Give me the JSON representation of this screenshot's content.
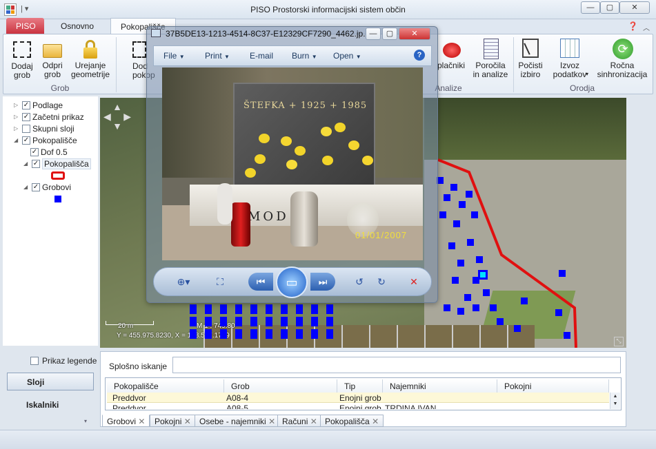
{
  "app": {
    "title": "PISO Prostorski informacijski sistem občin",
    "window_buttons": [
      "—",
      "▢",
      "✕"
    ]
  },
  "ribbon": {
    "tabs": [
      "PISO",
      "Osnovno",
      "Pokopališče"
    ],
    "group_grob": {
      "label": "Grob",
      "buttons": [
        "Dodaj\ngrob",
        "Odpri\ngrob",
        "Urejanje\ngeometrije"
      ]
    },
    "partial_button": "Dod\npokop",
    "group_analize": {
      "label": "Analize",
      "buttons": [
        "plačniki",
        "Poročila\nin analize"
      ]
    },
    "group_orodja": {
      "label": "Orodja",
      "buttons": [
        "Počisti\nizbiro",
        "Izvoz\npodatkov",
        "Ročna\nsinhronizacija"
      ]
    }
  },
  "layers": {
    "items": [
      {
        "label": "Podlage",
        "checked": true
      },
      {
        "label": "Začetni prikaz",
        "checked": true
      },
      {
        "label": "Skupni sloji",
        "checked": false
      },
      {
        "label": "Pokopališče",
        "checked": true
      },
      {
        "label": "Dof 0.5",
        "checked": true
      },
      {
        "label": "Pokopališča",
        "checked": true
      },
      {
        "label": "Grobovi",
        "checked": true
      }
    ],
    "legend_toggle": "Prikaz legende",
    "nav_sloji": "Sloji",
    "nav_iskalniki": "Iskalniki"
  },
  "map": {
    "scale_label": "20 m",
    "scale_text": "M 1 : 749.80",
    "coords": "Y = 455.975.8230, X = 128.507.1789"
  },
  "viewer": {
    "title": "37B5DE13-1213-4514-8C37-E12329CF7290_4462.jp...",
    "menu": [
      "File",
      "Print",
      "E-mail",
      "Burn",
      "Open"
    ],
    "help": "?",
    "photo_inscription": "ŠTEFKA + 1925 + 1985",
    "photo_letters": "MOD",
    "photo_date": "01/01/2007"
  },
  "search": {
    "label": "Splošno iskanje",
    "value": ""
  },
  "table": {
    "headers": [
      "Pokopališče",
      "Grob",
      "Tip",
      "Najemniki",
      "Pokojni"
    ],
    "rows": [
      [
        "Preddvor",
        "A08-4",
        "Enojni grob",
        "",
        ""
      ],
      [
        "Preddvor",
        "A08-5",
        "Enojni grob",
        "TRDINA IVAN",
        ""
      ]
    ]
  },
  "bottom_tabs": [
    "Grobovi",
    "Pokojni",
    "Osebe - najemniki",
    "Računi",
    "Pokopališča"
  ],
  "colors": {
    "accent_red": "#e01010",
    "grave_blue": "#0000ff",
    "selected_cyan": "#00e0ff",
    "piso_tab": "#c9303d"
  }
}
